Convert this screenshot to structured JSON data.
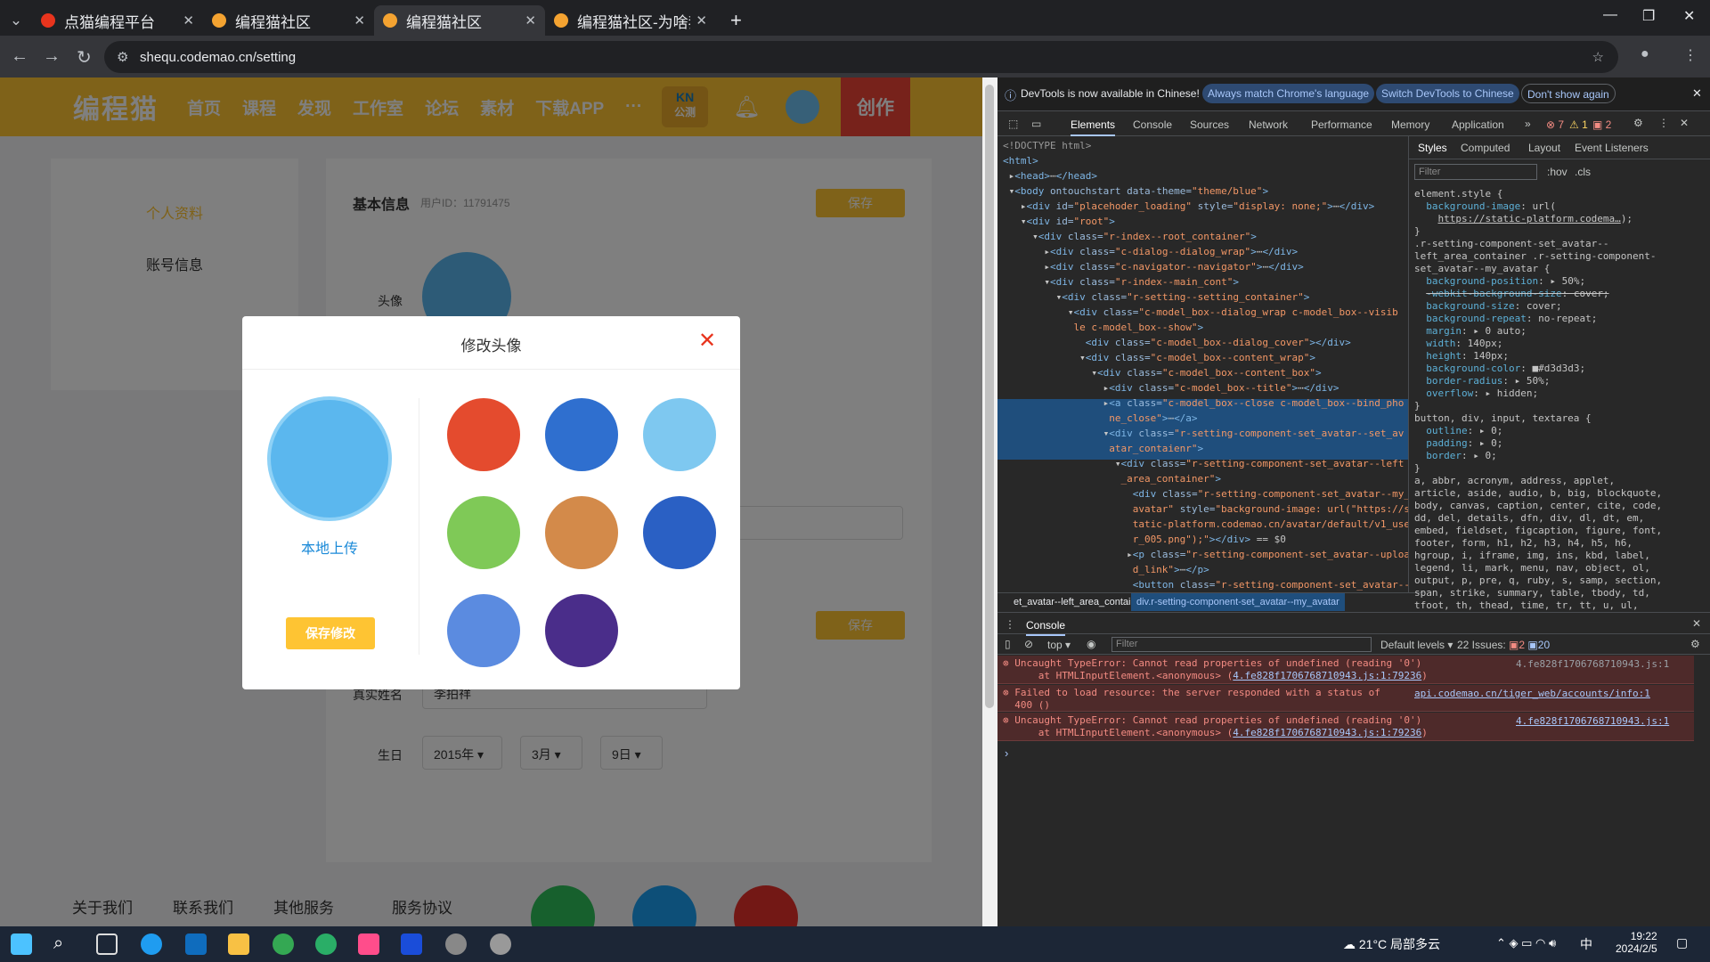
{
  "browser": {
    "tabs": [
      {
        "title": "点猫编程平台"
      },
      {
        "title": "编程猫社区"
      },
      {
        "title": "编程猫社区"
      },
      {
        "title": "编程猫社区-为啥我改不"
      }
    ],
    "new_tab": "+",
    "url": "sheq=u.codemao.cn/setting"
  },
  "site": {
    "logo": "编程猫",
    "nav": [
      "首页",
      "课程",
      "发现",
      "工作室",
      "论坛",
      "素材",
      "下载APP",
      "···"
    ],
    "kn_top": "KN",
    "kn_bottom": "公测",
    "create": "创作"
  },
  "settings": {
    "side": [
      "个人资料",
      "账号信息"
    ],
    "section_title": "基本信息",
    "user_id": "用户ID：11791475",
    "save": "保存",
    "avatar_label": "头像",
    "realname_label": "真实姓名",
    "realname_value": "李拍祥",
    "birthday_label": "生日",
    "year": "2015年",
    "month": "3月",
    "day": "9日"
  },
  "modal": {
    "title": "修改头像",
    "upload": "本地上传",
    "save_changes": "保存修改",
    "avatars": [
      "avatar-1",
      "avatar-2",
      "avatar-3",
      "avatar-4",
      "avatar-5",
      "avatar-6",
      "avatar-7",
      "avatar-8"
    ]
  },
  "footer": [
    "关于我们",
    "联系我们",
    "其他服务",
    "服务协议"
  ],
  "devtools": {
    "info": "DevTools is now available in Chinese!",
    "b1": "Always match Chrome's language",
    "b2": "Switch DevTools to Chinese",
    "b3": "Don't show again",
    "tabs": [
      "Elements",
      "Console",
      "Sources",
      "Network",
      "Performance",
      "Memory",
      "Application"
    ],
    "err_count": "7",
    "warn_count": "1",
    "info_count": "2",
    "style_tabs": [
      "Styles",
      "Computed",
      "Layout",
      "Event Listeners"
    ],
    "filter": "Filter",
    "hov": ":hov",
    ".cls": ".cls",
    "crumb1": "et_avatar--left_area_container",
    "crumb2": "div.r-setting-component-set_avatar--my_avatar",
    "console_tab": "Console",
    "context": "top",
    "levels": "Default levels",
    "issues": "22 Issues:",
    "issue_a": "2",
    "issue_b": "20",
    "console": [
      {
        "msg": "Uncaught TypeError: Cannot read properties of undefined (reading '0')",
        "at": "    at HTMLInputElement.<anonymous> (",
        "link": "4.fe828f1706768710943.js:1:79236",
        "src": "4.fe828f1706768710943.js:1"
      },
      {
        "msg": "Failed to load resource: the server responded with a status of",
        "at": "400 ()",
        "link": "",
        "src": "api.codemao.cn/tiger_web/accounts/info:1"
      },
      {
        "msg": "Uncaught TypeError: Cannot read properties of undefined (reading '0')",
        "at": "    at HTMLInputElement.<anonymous> (",
        "link": "4.fe828f1706768710943.js:1:79236",
        "src": "4.fe828f1706768710943.js:1"
      }
    ]
  },
  "taskbar": {
    "weather": "21°C 局部多云",
    "ime": "中",
    "time": "19:22",
    "date": "2024/2/5"
  }
}
